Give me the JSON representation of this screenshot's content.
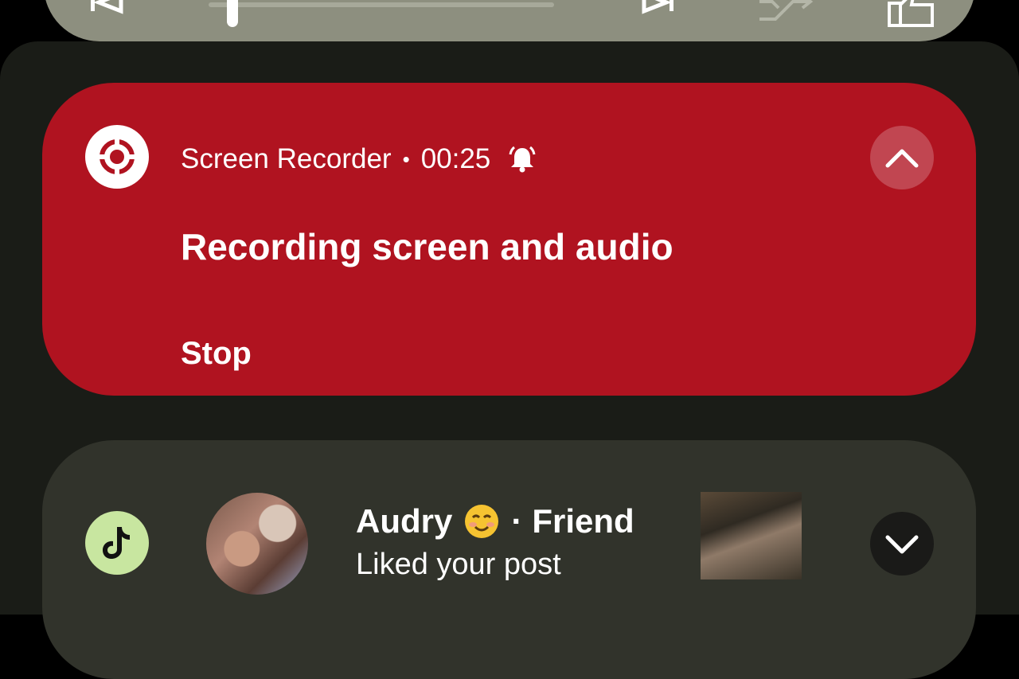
{
  "media": {
    "icons": [
      "skip-previous-icon",
      "skip-next-icon",
      "shuffle-icon",
      "thumbs-up-icon"
    ],
    "progress_fraction": 0.07
  },
  "recorder_notification": {
    "app_icon": "screen-record-icon",
    "app_name": "Screen Recorder",
    "separator": "•",
    "elapsed": "00:25",
    "alert_icon": "bell-icon",
    "title": "Recording screen and audio",
    "action_label": "Stop",
    "collapse_icon": "chevron-up-icon",
    "background_color": "#b01320"
  },
  "tiktok_notification": {
    "app_icon": "tiktok-icon",
    "sender_name": "Audry",
    "emoji": "☺️",
    "separator": "·",
    "relation": "Friend",
    "message": "Liked your post",
    "expand_icon": "chevron-down-icon"
  }
}
